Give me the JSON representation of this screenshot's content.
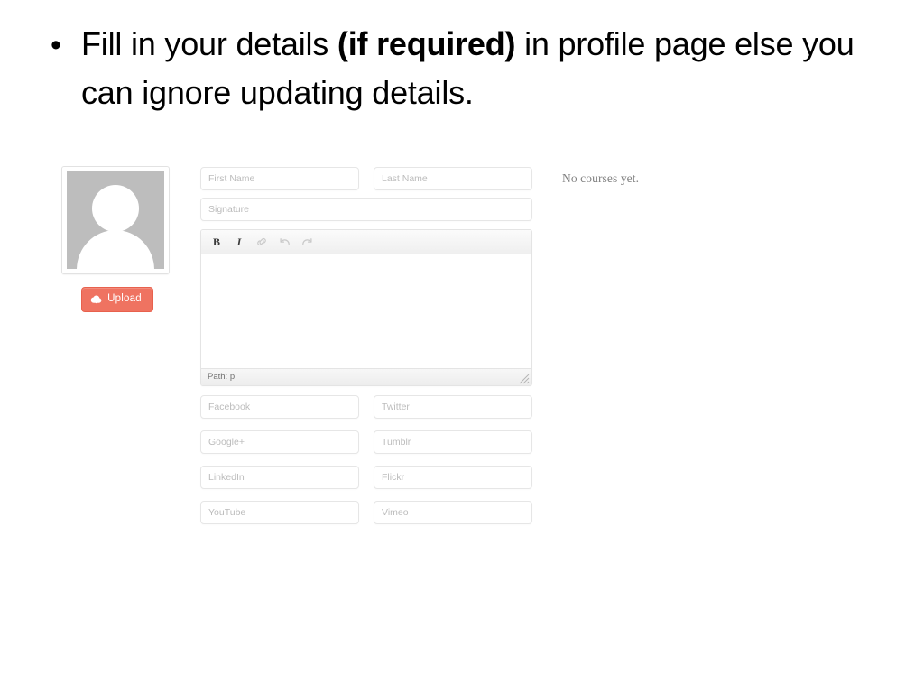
{
  "slide": {
    "bullet_marker": "•",
    "bullet_text_part1": "Fill in your details ",
    "bullet_text_bold": "(if required)",
    "bullet_text_part2": " in profile page else you can ignore updating details."
  },
  "avatar": {
    "name": "profile-avatar-placeholder",
    "upload_button_label": "Upload",
    "upload_icon": "cloud-upload-icon",
    "upload_button_color": "#ef7361",
    "placeholder_bg_color": "#bdbdbd"
  },
  "form": {
    "rows": [
      {
        "left_placeholder": "First Name",
        "right_placeholder": "Last Name"
      }
    ],
    "signature_placeholder": "Signature",
    "editor": {
      "toolbar_items": [
        {
          "name": "bold-button",
          "label": "B",
          "type": "text",
          "state": "enabled"
        },
        {
          "name": "italic-button",
          "label": "I",
          "type": "text",
          "state": "enabled"
        },
        {
          "name": "link-icon",
          "label": "",
          "type": "icon",
          "state": "disabled"
        },
        {
          "name": "undo-icon",
          "label": "",
          "type": "icon",
          "state": "disabled"
        },
        {
          "name": "redo-icon",
          "label": "",
          "type": "icon",
          "state": "disabled"
        }
      ],
      "body_value": "",
      "status_text": "Path: p"
    },
    "social_rows": [
      {
        "left_placeholder": "Facebook",
        "right_placeholder": "Twitter"
      },
      {
        "left_placeholder": "Google+",
        "right_placeholder": "Tumblr"
      },
      {
        "left_placeholder": "LinkedIn",
        "right_placeholder": "Flickr"
      },
      {
        "left_placeholder": "YouTube",
        "right_placeholder": "Vimeo"
      }
    ]
  },
  "courses": {
    "empty_message": "No courses yet."
  }
}
